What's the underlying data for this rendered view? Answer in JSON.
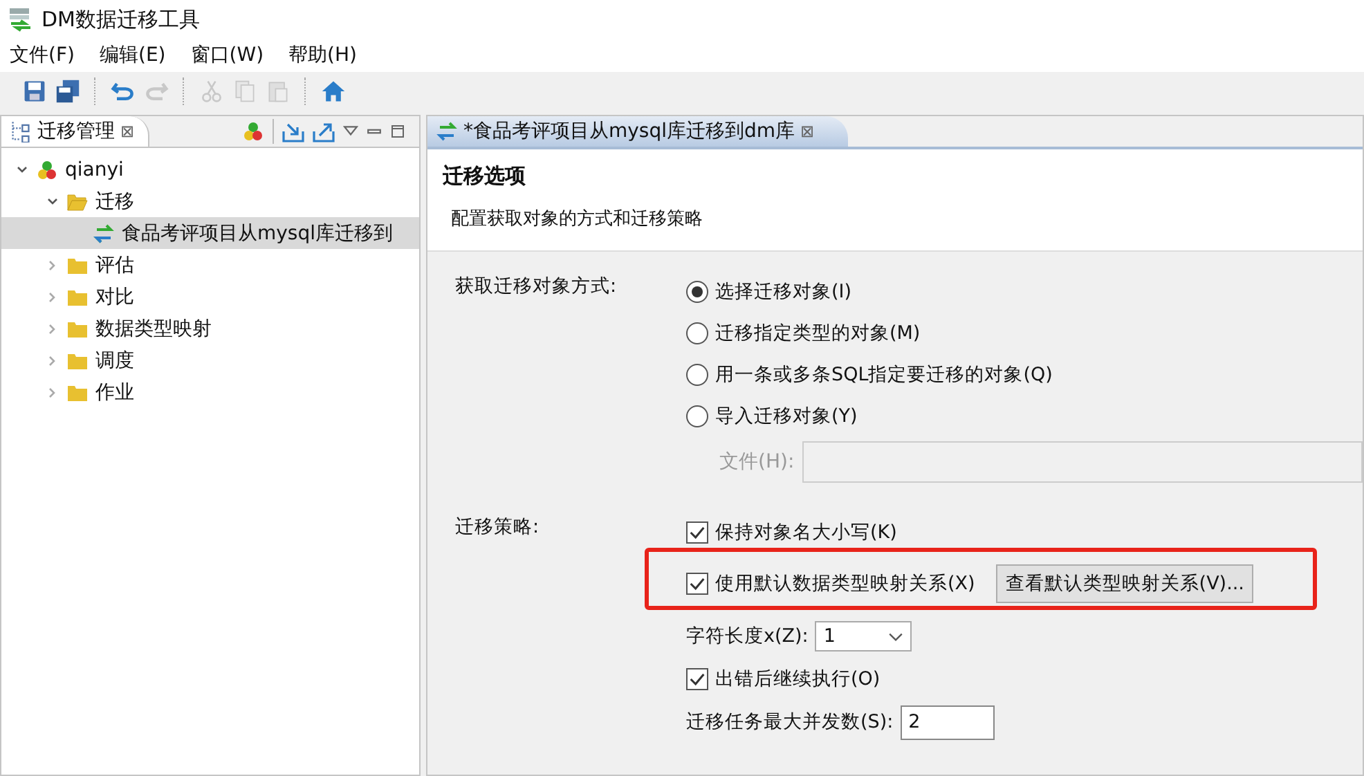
{
  "window": {
    "title": "DM数据迁移工具"
  },
  "menu": [
    "文件(F)",
    "编辑(E)",
    "窗口(W)",
    "帮助(H)"
  ],
  "toolbar": [
    {
      "kind": "save",
      "disabled": false
    },
    {
      "kind": "save-all",
      "disabled": false
    },
    {
      "kind": "sep"
    },
    {
      "kind": "undo",
      "disabled": false
    },
    {
      "kind": "redo",
      "disabled": true
    },
    {
      "kind": "sep"
    },
    {
      "kind": "cut",
      "disabled": true
    },
    {
      "kind": "copy",
      "disabled": true
    },
    {
      "kind": "paste",
      "disabled": true
    },
    {
      "kind": "sep"
    },
    {
      "kind": "home",
      "disabled": false
    }
  ],
  "left_view": {
    "tab": {
      "label": "迁移管理",
      "close": "⊠"
    },
    "tree": [
      {
        "label": "qianyi",
        "kind": "project",
        "expanded": true,
        "selected": false,
        "children": [
          {
            "label": "迁移",
            "kind": "folder",
            "expanded": true,
            "selected": false,
            "children": [
              {
                "label": "食品考评项目从mysql库迁移到",
                "kind": "task",
                "selected": true
              }
            ]
          },
          {
            "label": "评估",
            "kind": "folder",
            "expanded": false,
            "selected": false
          },
          {
            "label": "对比",
            "kind": "folder",
            "expanded": false,
            "selected": false
          },
          {
            "label": "数据类型映射",
            "kind": "folder",
            "expanded": false,
            "selected": false
          },
          {
            "label": "调度",
            "kind": "folder",
            "expanded": false,
            "selected": false
          },
          {
            "label": "作业",
            "kind": "folder",
            "expanded": false,
            "selected": false
          }
        ]
      }
    ]
  },
  "editor": {
    "tab": {
      "label": "*食品考评项目从mysql库迁移到dm库",
      "close": "⊠"
    },
    "title": "迁移选项",
    "description": "配置获取对象的方式和迁移策略",
    "fetch_label": "获取迁移对象方式:",
    "fetch_options": [
      {
        "label": "选择迁移对象(I)",
        "selected": true
      },
      {
        "label": "迁移指定类型的对象(M)",
        "selected": false
      },
      {
        "label": "用一条或多条SQL指定要迁移的对象(Q)",
        "selected": false
      },
      {
        "label": "导入迁移对象(Y)",
        "selected": false
      }
    ],
    "file_field": {
      "label": "文件(H):",
      "disabled": true
    },
    "strategy_label": "迁移策略:",
    "strategy": [
      {
        "kind": "check",
        "label": "保持对象名大小写(K)",
        "checked": true,
        "highlighted": false
      },
      {
        "kind": "check",
        "label": "使用默认数据类型映射关系(X)",
        "checked": true,
        "highlighted": true,
        "button": "查看默认类型映射关系(V)..."
      },
      {
        "kind": "combo",
        "label": "字符长度x(Z):",
        "value": "1"
      },
      {
        "kind": "check",
        "label": "出错后继续执行(O)",
        "checked": true,
        "highlighted": false
      },
      {
        "kind": "spinner",
        "label": "迁移任务最大并发数(S):",
        "value": "2"
      }
    ]
  }
}
